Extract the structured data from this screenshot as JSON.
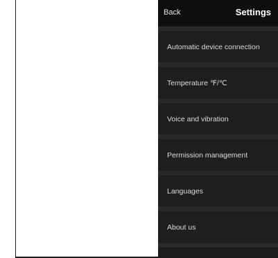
{
  "header": {
    "back_label": "Back",
    "title": "Settings"
  },
  "settings": {
    "items": [
      {
        "label": "Automatic device connection"
      },
      {
        "label": "Temperature ℉/℃"
      },
      {
        "label": "Voice and vibration"
      },
      {
        "label": "Permission management"
      },
      {
        "label": "Languages"
      },
      {
        "label": "About us"
      }
    ]
  },
  "colors": {
    "panel_background": "#1c1c1d",
    "header_background": "#0e0e0f",
    "divider": "#2a2a2c",
    "text": "#dcdcdc"
  }
}
